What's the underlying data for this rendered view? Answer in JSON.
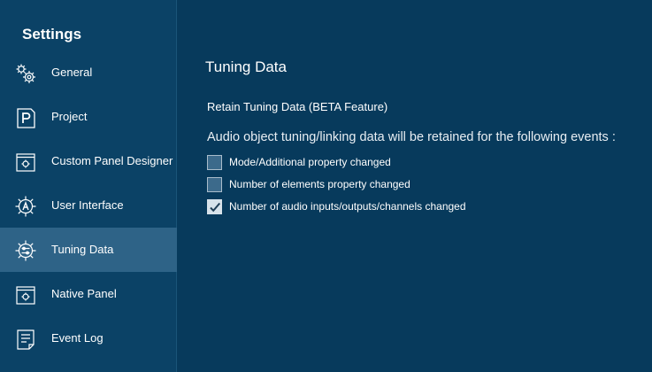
{
  "sidebar": {
    "title": "Settings",
    "active_index": 4,
    "items": [
      {
        "label": "General",
        "icon": "gears-icon"
      },
      {
        "label": "Project",
        "icon": "project-p-icon"
      },
      {
        "label": "Custom Panel Designer",
        "icon": "panel-designer-icon"
      },
      {
        "label": "User Interface",
        "icon": "user-interface-gear-icon"
      },
      {
        "label": "Tuning Data",
        "icon": "tuning-gear-icon"
      },
      {
        "label": "Native Panel",
        "icon": "native-panel-icon"
      },
      {
        "label": "Event Log",
        "icon": "event-log-icon"
      }
    ]
  },
  "main": {
    "title": "Tuning Data",
    "section_label": "Retain Tuning Data (BETA Feature)",
    "description": "Audio object tuning/linking data will be retained for the following events :",
    "options": [
      {
        "label": "Mode/Additional property changed",
        "checked": false
      },
      {
        "label": "Number of elements property changed",
        "checked": false
      },
      {
        "label": "Number of audio inputs/outputs/channels changed",
        "checked": true
      }
    ]
  },
  "colors": {
    "background": "#073a5c",
    "sidebar": "#0b4266",
    "active_item": "#2e6387"
  }
}
